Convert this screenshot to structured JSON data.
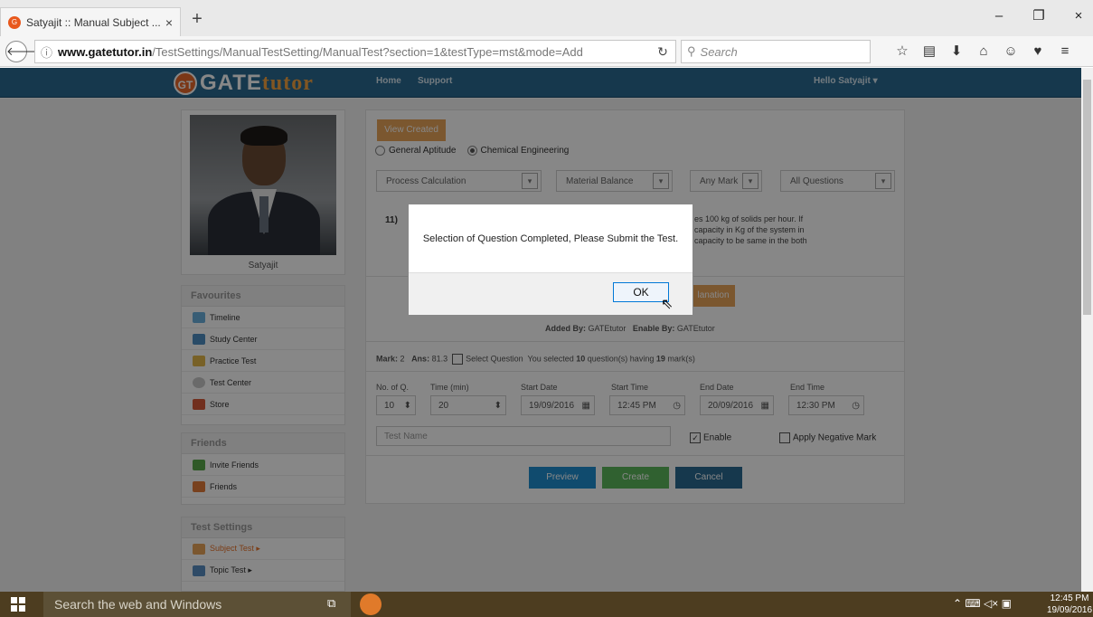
{
  "browser": {
    "tab_title": "Satyajit :: Manual Subject ...",
    "tab_close": "×",
    "new_tab": "+",
    "url_domain": "www.gatetutor.in",
    "url_path": "/TestSettings/ManualTestSetting/ManualTest?section=1&testType=mst&mode=Add",
    "search_placeholder": "Search",
    "window_controls": [
      "–",
      "❐",
      "×"
    ]
  },
  "site": {
    "logo_gt": "GT",
    "logo_gate": "GATE",
    "logo_tutor": "tutor",
    "nav": [
      "Home",
      "Support"
    ],
    "hello": "Hello Satyajit ▾"
  },
  "profile": {
    "name": "Satyajit"
  },
  "sidebar": {
    "favourites_title": "Favourites",
    "favourites": [
      "Timeline",
      "Study Center",
      "Practice Test",
      "Test Center",
      "Store"
    ],
    "friends_title": "Friends",
    "friends": [
      "Invite Friends",
      "Friends"
    ],
    "settings_title": "Test Settings",
    "settings": [
      "Subject Test ▸",
      "Topic Test ▸"
    ]
  },
  "main": {
    "view_created_test": "View Created Test",
    "radio_general": "General Aptitude",
    "radio_chemical": "Chemical Engineering",
    "selects": [
      "Process Calculation",
      "Material Balance",
      "Any Mark",
      "All Questions"
    ],
    "question_number": "11)",
    "question_text": [
      "es 100 kg of solids per hour. If",
      "capacity in Kg of the system in",
      "capacity to be same in the both"
    ],
    "explanation_btn": "lanation",
    "added_by_label": "Added By:",
    "added_by": "GATEtutor",
    "enable_by_label": "Enable By:",
    "enable_by": "GATEtutor",
    "mark_label": "Mark:",
    "mark": "2",
    "ans_label": "Ans:",
    "ans": "81.3",
    "select_question": "Select Question",
    "selected_text_a": "You selected",
    "selected_count": "10",
    "selected_text_b": "question(s) having",
    "selected_marks": "19",
    "selected_text_c": "mark(s)",
    "field_labels": [
      "No. of Q.",
      "Time (min)",
      "Start Date",
      "Start Time",
      "End Date",
      "End Time"
    ],
    "no_of_q": "10",
    "time_min": "20",
    "start_date": "19/09/2016",
    "start_time": "12:45 PM",
    "end_date": "20/09/2016",
    "end_time": "12:30 PM",
    "test_name_placeholder": "Test Name",
    "enable_label": "Enable",
    "negative_label": "Apply Negative Mark",
    "preview_btn": "Preview",
    "create_btn": "Create",
    "cancel_btn": "Cancel"
  },
  "dialog": {
    "message": "Selection of Question Completed, Please Submit the Test.",
    "ok": "OK"
  },
  "taskbar": {
    "search": "Search the web and Windows",
    "time": "12:45 PM",
    "date": "19/09/2016"
  },
  "colors": {
    "header": "#2b6a92",
    "orange": "#e8a45a",
    "blue_btn": "#1f8fd0",
    "green_btn": "#5cb85c",
    "cancel_btn": "#2b6a92"
  }
}
